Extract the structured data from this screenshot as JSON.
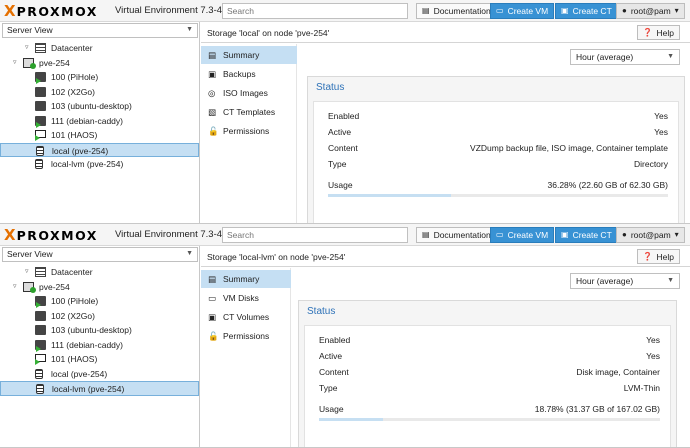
{
  "panels": [
    {
      "brand": {
        "logo_x": "X",
        "logo_text": "PROXMOX",
        "version": "Virtual Environment 7.3-4"
      },
      "search": {
        "placeholder": "Search"
      },
      "toolbar": {
        "docs": "Documentation",
        "create_vm": "Create VM",
        "create_ct": "Create CT",
        "user": "root@pam"
      },
      "view_select": "Server View",
      "tree": [
        {
          "label": "Datacenter",
          "icon": "datacenter-icon"
        },
        {
          "label": "pve-254",
          "icon": "node-icon"
        },
        {
          "label": "100 (PiHole)",
          "icon": "container-running-icon"
        },
        {
          "label": "102 (X2Go)",
          "icon": "container-icon"
        },
        {
          "label": "103 (ubuntu-desktop)",
          "icon": "container-icon"
        },
        {
          "label": "111 (debian-caddy)",
          "icon": "container-running-icon"
        },
        {
          "label": "101 (HAOS)",
          "icon": "vm-running-icon"
        },
        {
          "label": "local (pve-254)",
          "icon": "storage-icon"
        },
        {
          "label": "local-lvm (pve-254)",
          "icon": "storage-icon"
        }
      ],
      "selected_tree_index": 7,
      "header_title": "Storage 'local' on node 'pve-254'",
      "help": "Help",
      "nav": [
        {
          "label": "Summary",
          "icon": "summary-icon",
          "glyph": "▤"
        },
        {
          "label": "Backups",
          "icon": "backup-icon",
          "glyph": "▣"
        },
        {
          "label": "ISO Images",
          "icon": "disc-icon",
          "glyph": "◎"
        },
        {
          "label": "CT Templates",
          "icon": "template-icon",
          "glyph": "▧"
        },
        {
          "label": "Permissions",
          "icon": "unlock-icon",
          "glyph": "🔓"
        }
      ],
      "timeframe": "Hour (average)",
      "status": {
        "title": "Status",
        "rows": [
          {
            "label": "Enabled",
            "value": "Yes"
          },
          {
            "label": "Active",
            "value": "Yes"
          },
          {
            "label": "Content",
            "value": "VZDump backup file, ISO image, Container template"
          },
          {
            "label": "Type",
            "value": "Directory"
          }
        ],
        "usage_label": "Usage",
        "usage_value": "36.28% (22.60 GB of 62.30 GB)",
        "usage_fraction": 0.3628
      }
    },
    {
      "brand": {
        "logo_x": "X",
        "logo_text": "PROXMOX",
        "version": "Virtual Environment 7.3-4"
      },
      "search": {
        "placeholder": "Search"
      },
      "toolbar": {
        "docs": "Documentation",
        "create_vm": "Create VM",
        "create_ct": "Create CT",
        "user": "root@pam"
      },
      "view_select": "Server View",
      "tree": [
        {
          "label": "Datacenter",
          "icon": "datacenter-icon"
        },
        {
          "label": "pve-254",
          "icon": "node-icon"
        },
        {
          "label": "100 (PiHole)",
          "icon": "container-running-icon"
        },
        {
          "label": "102 (X2Go)",
          "icon": "container-icon"
        },
        {
          "label": "103 (ubuntu-desktop)",
          "icon": "container-icon"
        },
        {
          "label": "111 (debian-caddy)",
          "icon": "container-running-icon"
        },
        {
          "label": "101 (HAOS)",
          "icon": "vm-running-icon"
        },
        {
          "label": "local (pve-254)",
          "icon": "storage-icon"
        },
        {
          "label": "local-lvm (pve-254)",
          "icon": "storage-icon"
        }
      ],
      "selected_tree_index": 8,
      "header_title": "Storage 'local-lvm' on node 'pve-254'",
      "help": "Help",
      "nav": [
        {
          "label": "Summary",
          "icon": "summary-icon",
          "glyph": "▤"
        },
        {
          "label": "VM Disks",
          "icon": "vm-disk-icon",
          "glyph": "▭"
        },
        {
          "label": "CT Volumes",
          "icon": "ct-volume-icon",
          "glyph": "▣"
        },
        {
          "label": "Permissions",
          "icon": "unlock-icon",
          "glyph": "🔓"
        }
      ],
      "timeframe": "Hour (average)",
      "status": {
        "title": "Status",
        "rows": [
          {
            "label": "Enabled",
            "value": "Yes"
          },
          {
            "label": "Active",
            "value": "Yes"
          },
          {
            "label": "Content",
            "value": "Disk image, Container"
          },
          {
            "label": "Type",
            "value": "LVM-Thin"
          }
        ],
        "usage_label": "Usage",
        "usage_value": "18.78% (31.37 GB of 167.02 GB)",
        "usage_fraction": 0.1878
      }
    }
  ]
}
